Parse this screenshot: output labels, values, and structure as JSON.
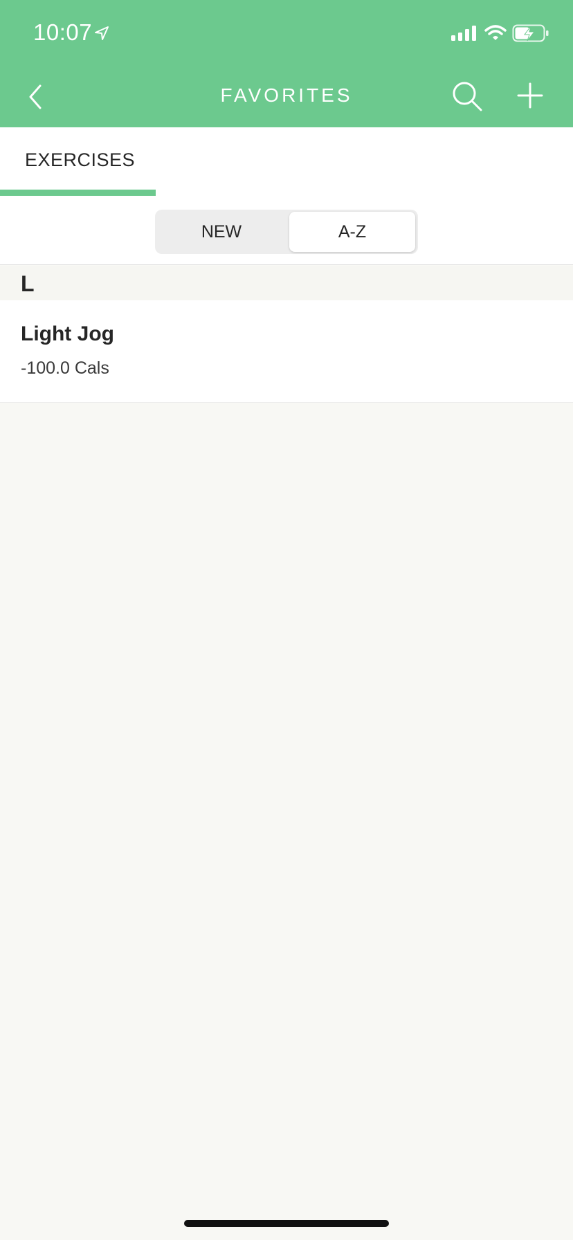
{
  "status_bar": {
    "time": "10:07"
  },
  "header": {
    "title": "FAVORITES",
    "background_color": "#6cc98e"
  },
  "tabs": [
    {
      "label": "EXERCISES",
      "active": true
    }
  ],
  "segmented_control": {
    "options": [
      "NEW",
      "A-Z"
    ],
    "selected": "A-Z"
  },
  "list": {
    "sections": [
      {
        "letter": "L",
        "items": [
          {
            "title": "Light Jog",
            "subtitle": "-100.0 Cals"
          }
        ]
      }
    ]
  },
  "icons": {
    "back": "chevron-left-icon",
    "search": "search-icon",
    "add": "plus-icon",
    "location": "location-arrow-icon",
    "signal": "signal-icon",
    "wifi": "wifi-icon",
    "battery": "battery-charging-icon"
  }
}
